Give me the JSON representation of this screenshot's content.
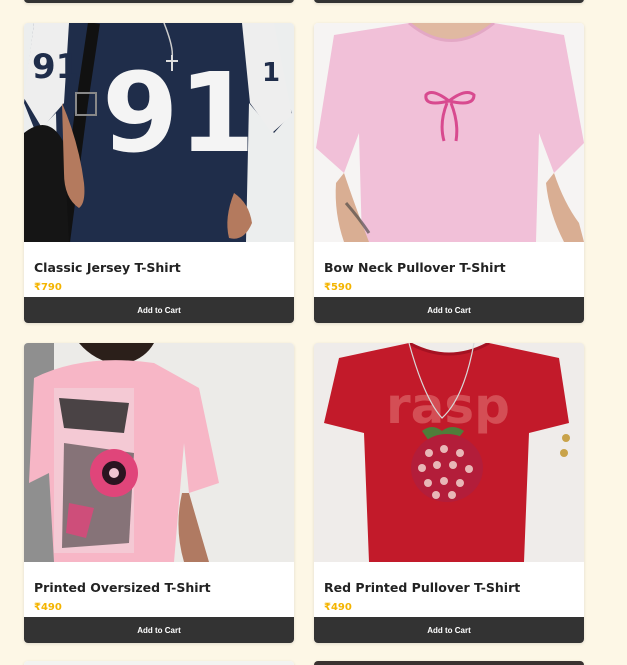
{
  "products": [
    {
      "name": "Classic Jersey T-Shirt",
      "price": "₹790",
      "button_label": "Add to Cart",
      "image_name": "classic-jersey-tshirt-image",
      "jersey_number": "91"
    },
    {
      "name": "Bow Neck Pullover T-Shirt",
      "price": "₹590",
      "button_label": "Add to Cart",
      "image_name": "bow-neck-pullover-tshirt-image"
    },
    {
      "name": "Printed Oversized T-Shirt",
      "price": "₹490",
      "button_label": "Add to Cart",
      "image_name": "printed-oversized-tshirt-image"
    },
    {
      "name": "Red Printed Pullover T-Shirt",
      "price": "₹490",
      "button_label": "Add to Cart",
      "image_name": "red-printed-pullover-tshirt-image",
      "print_text": "rasp"
    }
  ],
  "colors": {
    "page_background": "#fdf7e6",
    "card_background": "#ffffff",
    "button_background": "#333333",
    "button_text": "#ffffff",
    "price": "#f4b400",
    "title": "#222222"
  }
}
